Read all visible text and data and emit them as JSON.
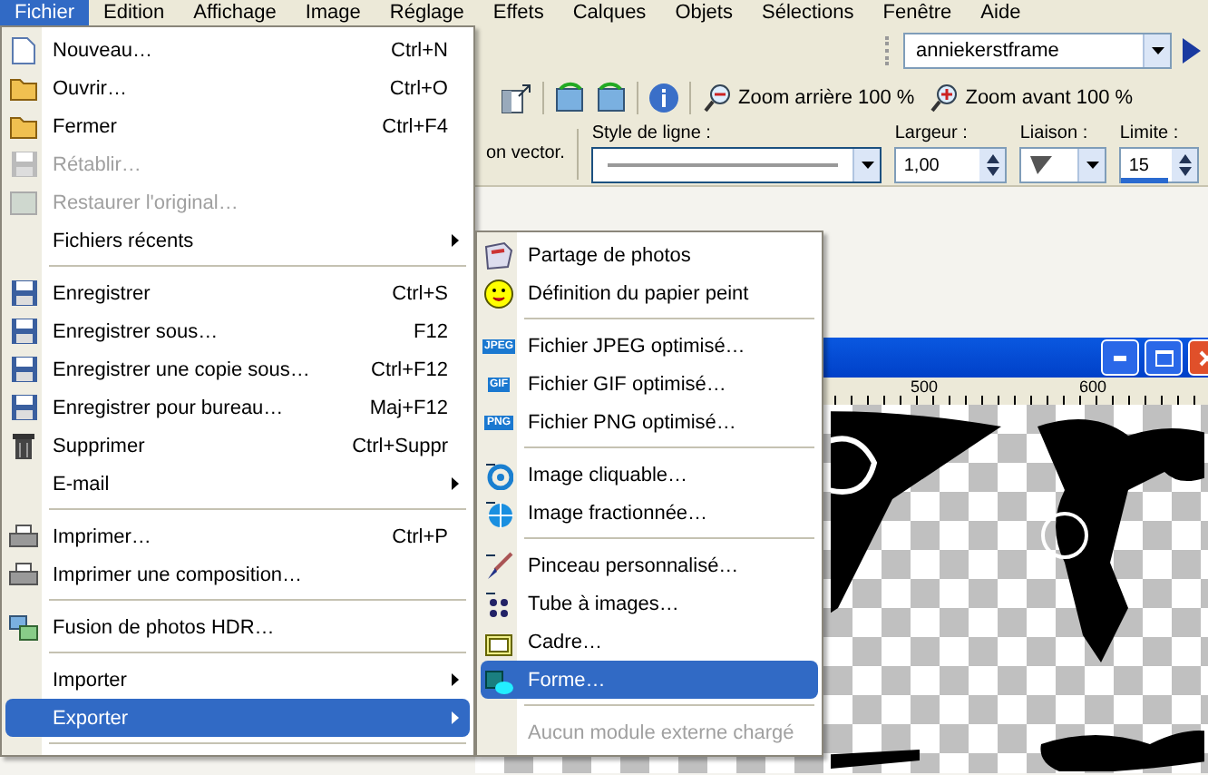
{
  "menubar": [
    {
      "label": "Fichier",
      "selected": true
    },
    {
      "label": "Edition",
      "selected": false
    },
    {
      "label": "Affichage",
      "selected": false
    },
    {
      "label": "Image",
      "selected": false
    },
    {
      "label": "Réglage",
      "selected": false
    },
    {
      "label": "Effets",
      "selected": false
    },
    {
      "label": "Calques",
      "selected": false
    },
    {
      "label": "Objets",
      "selected": false
    },
    {
      "label": "Sélections",
      "selected": false
    },
    {
      "label": "Fenêtre",
      "selected": false
    },
    {
      "label": "Aide",
      "selected": false
    }
  ],
  "toolbar": {
    "preset_value": "anniekerstframe",
    "zoom_out": "Zoom arrière 100 %",
    "zoom_in": "Zoom avant 100 %"
  },
  "options": {
    "partial_label": "on vector.",
    "line_style_label": "Style de ligne :",
    "width_label": "Largeur :",
    "width_value": "1,00",
    "join_label": "Liaison :",
    "limit": {
      "label": "Limite :",
      "value": "15",
      "level": 0.6
    }
  },
  "image_window": {
    "ruler_labels": [
      "500",
      "600"
    ]
  },
  "file_menu": [
    {
      "kind": "item",
      "label": "Nouveau…",
      "shortcut": "Ctrl+N",
      "disabled": false,
      "selected": false,
      "submenu": false
    },
    {
      "kind": "item",
      "label": "Ouvrir…",
      "shortcut": "Ctrl+O",
      "disabled": false,
      "selected": false,
      "submenu": false
    },
    {
      "kind": "item",
      "label": "Fermer",
      "shortcut": "Ctrl+F4",
      "disabled": false,
      "selected": false,
      "submenu": false
    },
    {
      "kind": "item",
      "label": "Rétablir…",
      "disabled": true,
      "selected": false,
      "submenu": false
    },
    {
      "kind": "item",
      "label": "Restaurer l'original…",
      "disabled": true,
      "selected": false,
      "submenu": false
    },
    {
      "kind": "item",
      "label": "Fichiers récents",
      "disabled": false,
      "selected": false,
      "submenu": true
    },
    {
      "kind": "separator"
    },
    {
      "kind": "item",
      "label": "Enregistrer",
      "shortcut": "Ctrl+S",
      "disabled": false,
      "selected": false,
      "submenu": false
    },
    {
      "kind": "item",
      "label": "Enregistrer sous…",
      "shortcut": "F12",
      "disabled": false,
      "selected": false,
      "submenu": false
    },
    {
      "kind": "item",
      "label": "Enregistrer une copie sous…",
      "shortcut": "Ctrl+F12",
      "disabled": false,
      "selected": false,
      "submenu": false
    },
    {
      "kind": "item",
      "label": "Enregistrer pour bureau…",
      "shortcut": "Maj+F12",
      "disabled": false,
      "selected": false,
      "submenu": false
    },
    {
      "kind": "item",
      "label": "Supprimer",
      "shortcut": "Ctrl+Suppr",
      "disabled": false,
      "selected": false,
      "submenu": false
    },
    {
      "kind": "item",
      "label": "E-mail",
      "disabled": false,
      "selected": false,
      "submenu": true
    },
    {
      "kind": "separator"
    },
    {
      "kind": "item",
      "label": "Imprimer…",
      "shortcut": "Ctrl+P",
      "disabled": false,
      "selected": false,
      "submenu": false
    },
    {
      "kind": "item",
      "label": "Imprimer une composition…",
      "disabled": false,
      "selected": false,
      "submenu": false
    },
    {
      "kind": "separator"
    },
    {
      "kind": "item",
      "label": "Fusion de photos HDR…",
      "disabled": false,
      "selected": false,
      "submenu": false
    },
    {
      "kind": "separator"
    },
    {
      "kind": "item",
      "label": "Importer",
      "disabled": false,
      "selected": false,
      "submenu": true
    },
    {
      "kind": "item",
      "label": "Exporter",
      "disabled": false,
      "selected": true,
      "submenu": true
    },
    {
      "kind": "separator"
    }
  ],
  "export_submenu": [
    {
      "kind": "item",
      "label": "Partage de photos",
      "disabled": false,
      "selected": false
    },
    {
      "kind": "item",
      "label": "Définition du papier peint",
      "disabled": false,
      "selected": false
    },
    {
      "kind": "separator"
    },
    {
      "kind": "item",
      "label": "Fichier JPEG optimisé…",
      "badge": "JPEG",
      "disabled": false,
      "selected": false
    },
    {
      "kind": "item",
      "label": "Fichier GIF optimisé…",
      "badge": "GIF",
      "disabled": false,
      "selected": false
    },
    {
      "kind": "item",
      "label": "Fichier PNG optimisé…",
      "badge": "PNG",
      "disabled": false,
      "selected": false
    },
    {
      "kind": "separator"
    },
    {
      "kind": "item",
      "label": "Image cliquable…",
      "disabled": false,
      "selected": false
    },
    {
      "kind": "item",
      "label": "Image fractionnée…",
      "disabled": false,
      "selected": false
    },
    {
      "kind": "separator"
    },
    {
      "kind": "item",
      "label": "Pinceau personnalisé…",
      "disabled": false,
      "selected": false
    },
    {
      "kind": "item",
      "label": "Tube à images…",
      "disabled": false,
      "selected": false
    },
    {
      "kind": "item",
      "label": "Cadre…",
      "disabled": false,
      "selected": false
    },
    {
      "kind": "item",
      "label": "Forme…",
      "disabled": false,
      "selected": true
    },
    {
      "kind": "separator"
    },
    {
      "kind": "item",
      "label": "Aucun module externe chargé",
      "disabled": true,
      "selected": false
    }
  ]
}
